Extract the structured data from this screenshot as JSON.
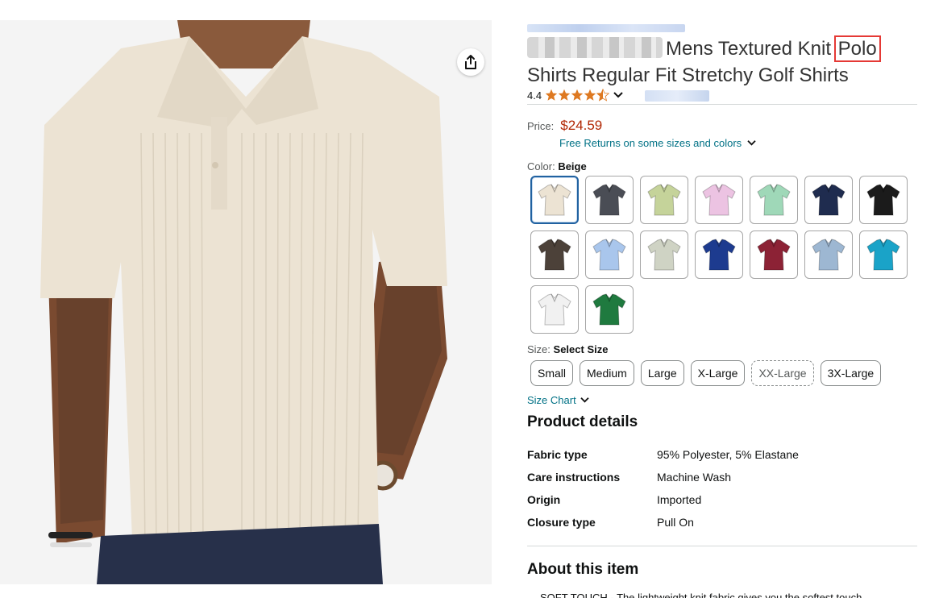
{
  "product": {
    "title_suffix": "Mens Textured Knit",
    "title_highlight": "Polo",
    "title_line2": "Shirts Regular Fit Stretchy Golf Shirts",
    "rating_value": "4.4",
    "stars": 4.4,
    "price_label": "Price:",
    "price": "$24.59",
    "returns_text": "Free Returns on some sizes and colors",
    "color_label": "Color:",
    "color_selected": "Beige",
    "size_label": "Size:",
    "size_selected": "Select Size",
    "size_chart": "Size Chart"
  },
  "swatches": [
    {
      "name": "beige",
      "color": "#ece3d3",
      "selected": true
    },
    {
      "name": "charcoal",
      "color": "#4a4d55"
    },
    {
      "name": "sage",
      "color": "#c5d39a"
    },
    {
      "name": "pink",
      "color": "#ecc3e2"
    },
    {
      "name": "mint",
      "color": "#9fd8b8"
    },
    {
      "name": "navy",
      "color": "#1f2c4f"
    },
    {
      "name": "black",
      "color": "#1b1b1b"
    },
    {
      "name": "brown",
      "color": "#4c4139"
    },
    {
      "name": "light-blue",
      "color": "#a9c6ec"
    },
    {
      "name": "light-grey",
      "color": "#cfd3c4"
    },
    {
      "name": "royal-blue",
      "color": "#1d3b8f"
    },
    {
      "name": "burgundy",
      "color": "#8c2235"
    },
    {
      "name": "steel-blue",
      "color": "#9db7d2"
    },
    {
      "name": "turquoise",
      "color": "#1aa3c8"
    },
    {
      "name": "white",
      "color": "#f1f1f1"
    },
    {
      "name": "green",
      "color": "#1f7a3f"
    }
  ],
  "sizes": [
    "Small",
    "Medium",
    "Large",
    "X-Large",
    "XX-Large",
    "3X-Large"
  ],
  "sizes_unavailable": [
    "XX-Large"
  ],
  "details_title": "Product details",
  "details": [
    {
      "k": "Fabric type",
      "v": "95% Polyester, 5% Elastane"
    },
    {
      "k": "Care instructions",
      "v": "Machine Wash"
    },
    {
      "k": "Origin",
      "v": "Imported"
    },
    {
      "k": "Closure type",
      "v": "Pull On"
    }
  ],
  "about_title": "About this item",
  "about_first_line": "SOFT TOUCH - The lightweight knit fabric gives you the softest touch",
  "colors": {
    "link": "#007185",
    "price": "#b12704",
    "star": "#de7921",
    "selected_border": "#2162a1",
    "highlight_box": "#e53935"
  }
}
